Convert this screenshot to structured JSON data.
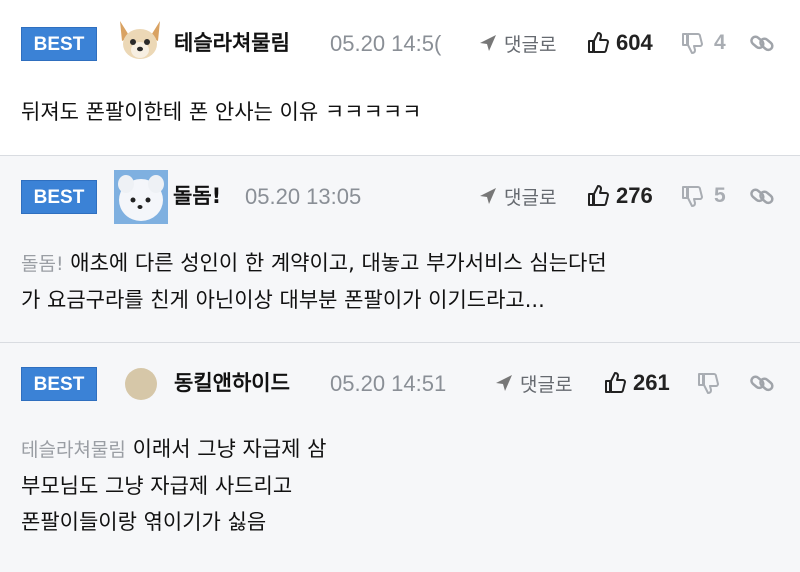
{
  "comments": [
    {
      "badge": "BEST",
      "nickname": "테슬라쳐물림",
      "date": "05.20 14:5(",
      "reply_label": "댓글로",
      "likes": "604",
      "dislikes": "4",
      "avatar": "dog-avatar",
      "lines": [
        "뒤져도 폰팔이한테 폰 안사는 이유 ㅋㅋㅋㅋㅋ"
      ]
    },
    {
      "badge": "BEST",
      "nickname": "돌돔!",
      "date": "05.20 13:05",
      "reply_label": "댓글로",
      "likes": "276",
      "dislikes": "5",
      "avatar": "white-dog-avatar",
      "mention": "돌돔!",
      "lines": [
        "애초에 다른 성인이 한 계약이고, 대놓고 부가서비스 심는다던",
        "가 요금구라를 친게 아닌이상 대부분 폰팔이가 이기드라고..."
      ]
    },
    {
      "badge": "BEST",
      "nickname": "동킬앤하이드",
      "date": "05.20 14:51",
      "reply_label": "댓글로",
      "likes": "261",
      "dislikes": "",
      "avatar": "default-avatar",
      "mention": "테슬라쳐물림",
      "lines": [
        "이래서 그냥 자급제 삼",
        "부모님도 그냥 자급제 사드리고",
        "폰팔이들이랑 엮이기가 싫음"
      ]
    }
  ],
  "colors": {
    "best_badge": "#3b82d6",
    "comment_bg": "#f6f7f9",
    "muted": "#8a8f96"
  }
}
